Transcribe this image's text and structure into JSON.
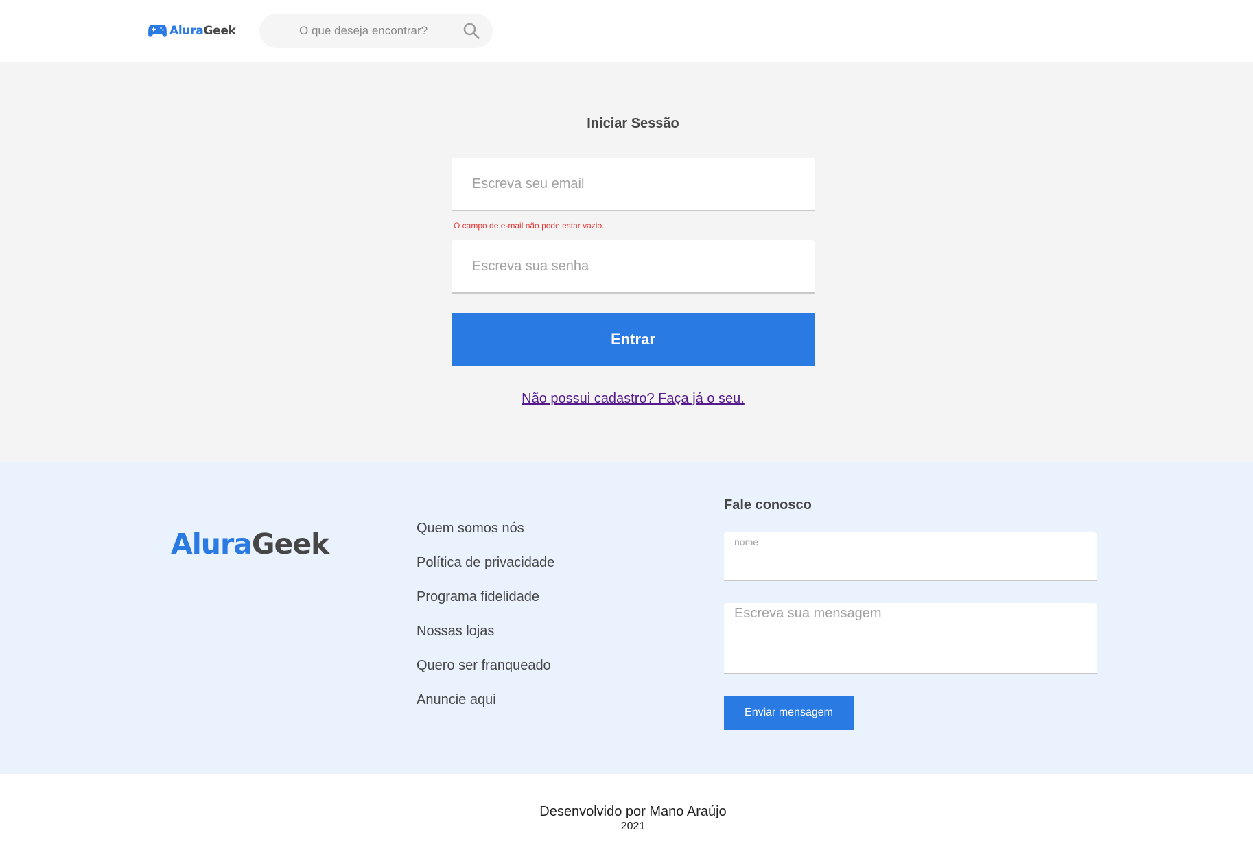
{
  "header": {
    "brand_part1": "Alura",
    "brand_part2": "Geek",
    "logo_icon": "gamepad-icon",
    "search": {
      "placeholder": "O que deseja encontrar?",
      "value": "",
      "icon": "search-icon"
    }
  },
  "login": {
    "title": "Iniciar Sessão",
    "email_placeholder": "Escreva seu email",
    "email_value": "",
    "email_error": "O campo de e-mail não pode estar vazio.",
    "password_placeholder": "Escreva sua senha",
    "password_value": "",
    "submit_label": "Entrar",
    "signup_link": "Não possui cadastro? Faça já o seu."
  },
  "footer": {
    "logo_part1": "Alura",
    "logo_part2": "Geek",
    "links": [
      "Quem somos nós",
      "Política de privacidade",
      "Programa fidelidade",
      "Nossas lojas",
      "Quero ser franqueado",
      "Anuncie aqui"
    ],
    "contact": {
      "title": "Fale conosco",
      "name_label": "nome",
      "name_value": "",
      "message_placeholder": "Escreva sua mensagem",
      "message_value": "",
      "send_label": "Enviar mensagem"
    }
  },
  "credits": {
    "line1": "Desenvolvido por Mano Araújo",
    "line2": "2021"
  },
  "colors": {
    "accent": "#2a7ae4",
    "text_dark": "#464646",
    "main_bg": "#f4f4f4",
    "footer_bg": "#eaf2fd",
    "error": "#e53935",
    "visited_link": "#551a8b"
  }
}
